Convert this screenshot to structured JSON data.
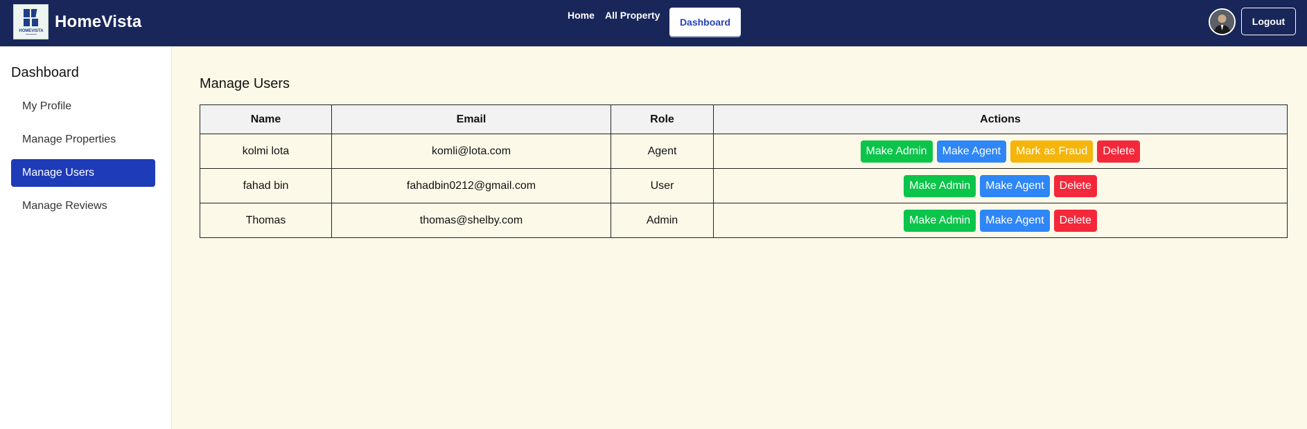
{
  "navbar": {
    "brand": "HomeVista",
    "logo_text": "HOMEVISTA",
    "links": {
      "home": "Home",
      "all_property": "All Property",
      "dashboard": "Dashboard"
    },
    "logout": "Logout",
    "bg_color": "#19265a"
  },
  "sidebar": {
    "title": "Dashboard",
    "items": [
      {
        "label": "My Profile",
        "active": false
      },
      {
        "label": "Manage Properties",
        "active": false
      },
      {
        "label": "Manage Users",
        "active": true
      },
      {
        "label": "Manage Reviews",
        "active": false
      }
    ],
    "active_color": "#1e3bb8"
  },
  "main": {
    "title": "Manage Users",
    "table": {
      "headers": [
        "Name",
        "Email",
        "Role",
        "Actions"
      ],
      "rows": [
        {
          "name": "kolmi lota",
          "email": "komli@lota.com",
          "role": "Agent",
          "actions": [
            "Make Admin",
            "Make Agent",
            "Mark as Fraud",
            "Delete"
          ]
        },
        {
          "name": "fahad bin",
          "email": "fahadbin0212@gmail.com",
          "role": "User",
          "actions": [
            "Make Admin",
            "Make Agent",
            "Delete"
          ]
        },
        {
          "name": "Thomas",
          "email": "thomas@shelby.com",
          "role": "Admin",
          "actions": [
            "Make Admin",
            "Make Agent",
            "Delete"
          ]
        }
      ]
    },
    "action_colors": {
      "make_admin": "#0bc44a",
      "make_agent": "#2f86f6",
      "mark_fraud": "#f5b50a",
      "delete": "#f4283a"
    }
  }
}
